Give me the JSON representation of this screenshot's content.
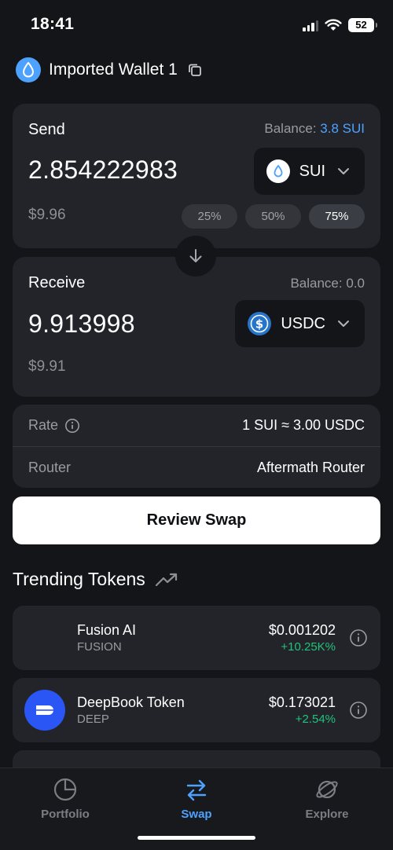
{
  "status_bar": {
    "time": "18:41",
    "battery": "52"
  },
  "wallet": {
    "name": "Imported Wallet 1"
  },
  "send": {
    "label": "Send",
    "balance_label": "Balance:",
    "balance_value": "3.8 SUI",
    "amount": "2.854222983",
    "fiat": "$9.96",
    "token": "SUI",
    "percent_options": [
      "25%",
      "50%",
      "75%"
    ],
    "selected_percent": "75%"
  },
  "receive": {
    "label": "Receive",
    "balance_label": "Balance:",
    "balance_value": "0.0",
    "amount": "9.913998",
    "fiat": "$9.91",
    "token": "USDC"
  },
  "details": {
    "rate_label": "Rate",
    "rate_value": "1 SUI ≈ 3.00 USDC",
    "router_label": "Router",
    "router_value": "Aftermath Router"
  },
  "review_button": "Review Swap",
  "trending": {
    "title": "Trending Tokens",
    "tokens": [
      {
        "name": "Fusion AI",
        "symbol": "FUSION",
        "price": "$0.001202",
        "change": "+10.25K%"
      },
      {
        "name": "DeepBook Token",
        "symbol": "DEEP",
        "price": "$0.173021",
        "change": "+2.54%"
      }
    ]
  },
  "tabs": [
    {
      "label": "Portfolio",
      "icon": "pie-chart-icon",
      "active": false
    },
    {
      "label": "Swap",
      "icon": "swap-arrows-icon",
      "active": true
    },
    {
      "label": "Explore",
      "icon": "planet-icon",
      "active": false
    }
  ],
  "colors": {
    "accent": "#4da2ff",
    "positive": "#22c27a",
    "background": "#141519",
    "card": "#22242a"
  }
}
